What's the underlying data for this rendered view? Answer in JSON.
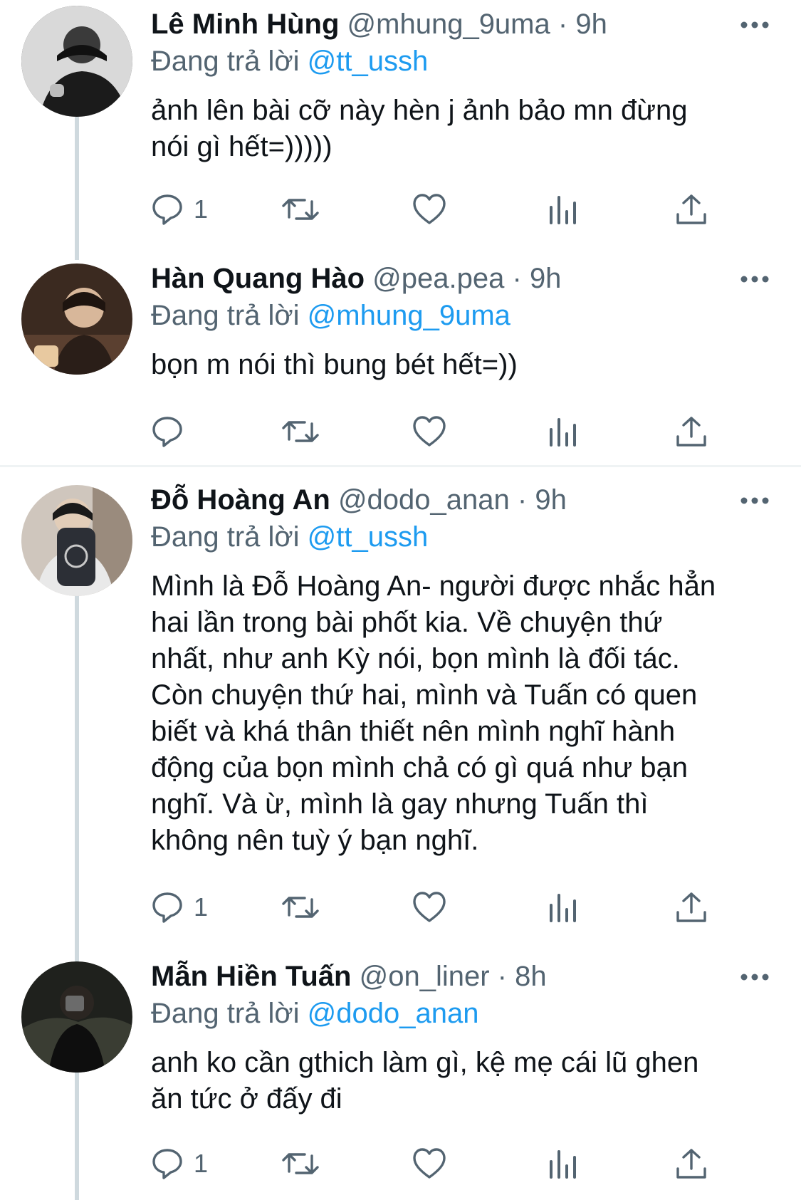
{
  "tweets": [
    {
      "name": "Lê Minh Hùng",
      "handle": "@mhung_9uma",
      "dot": "·",
      "time": "9h",
      "reply_prefix": "Đang trả lời",
      "reply_to": "@tt_ussh",
      "lines": [
        "ảnh lên bài cỡ này hèn j ảnh bảo mn đừng",
        "nói gì hết=)))))"
      ],
      "reply_count": "1"
    },
    {
      "name": "Hàn Quang Hào",
      "handle": "@pea.pea",
      "dot": "·",
      "time": "9h",
      "reply_prefix": "Đang trả lời",
      "reply_to": "@mhung_9uma",
      "lines": [
        "bọn m nói thì bung bét hết=))"
      ],
      "reply_count": ""
    },
    {
      "name": "Đỗ Hoàng An",
      "handle": "@dodo_anan",
      "dot": "·",
      "time": "9h",
      "reply_prefix": "Đang trả lời",
      "reply_to": "@tt_ussh",
      "lines": [
        "Mình là Đỗ Hoàng An- người được nhắc hẳn",
        "hai lần trong bài phốt kia. Về chuyện thứ",
        "nhất, như anh Kỳ nói, bọn mình là đối tác.",
        "Còn chuyện thứ hai, mình và Tuấn có quen",
        "biết và khá thân thiết nên mình nghĩ hành",
        "động của bọn mình chả có gì quá như bạn",
        "nghĩ. Và ừ, mình là gay nhưng Tuấn thì",
        "không nên tuỳ ý bạn nghĩ."
      ],
      "reply_count": "1"
    },
    {
      "name": "Mẫn Hiền Tuấn",
      "handle": "@on_liner",
      "dot": "·",
      "time": "8h",
      "reply_prefix": "Đang trả lời",
      "reply_to": "@dodo_anan",
      "lines": [
        "anh ko cần gthich làm gì, kệ mẹ cái lũ ghen",
        "ăn tức ở đấy đi"
      ],
      "reply_count": "1"
    }
  ],
  "icons": {
    "reply": "reply-bubble-icon",
    "retweet": "retweet-icon",
    "like": "heart-icon",
    "analytics": "analytics-icon",
    "share": "share-icon",
    "more": "more-dots-icon"
  },
  "colors": {
    "accent": "#1d9bf0",
    "secondary_text": "#536471",
    "primary_text": "#0f1419",
    "thread_line": "#cfd9de"
  }
}
